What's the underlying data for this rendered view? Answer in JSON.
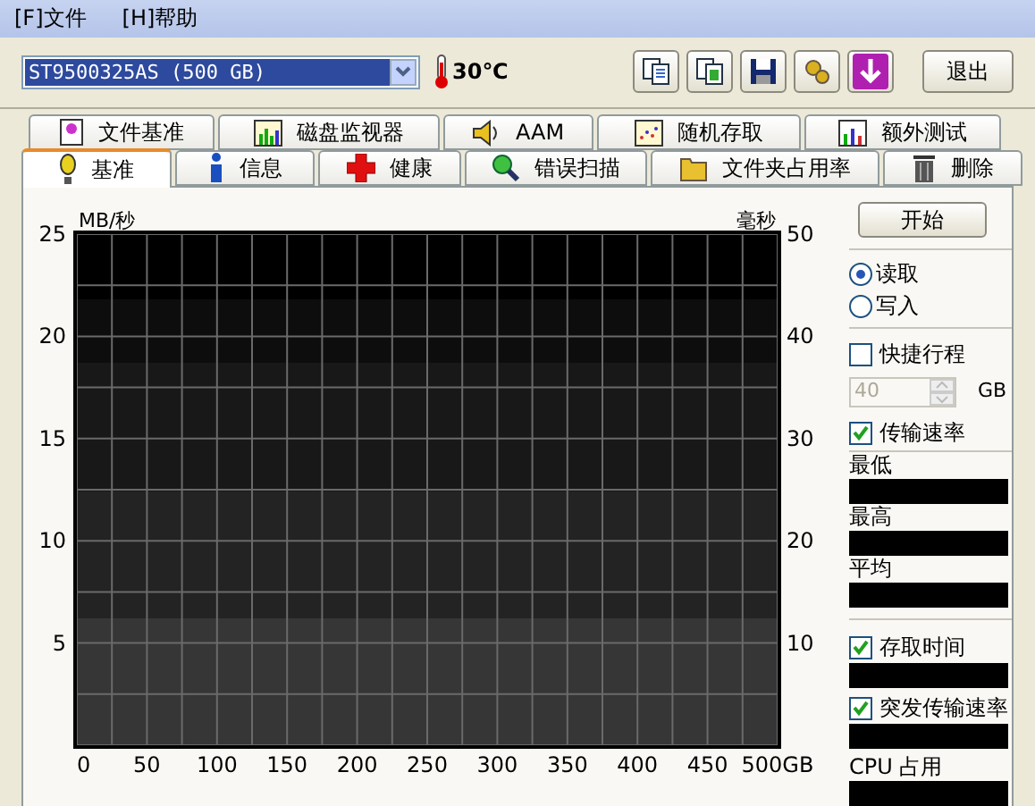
{
  "menu": [
    {
      "label": "[F]文件"
    },
    {
      "label": "[H]帮助"
    }
  ],
  "toolbar": {
    "drive": "ST9500325AS (500 GB)",
    "temperature": "30℃",
    "tools": [
      {
        "kind": "copy"
      },
      {
        "kind": "copy-color"
      },
      {
        "kind": "save"
      },
      {
        "kind": "options"
      },
      {
        "kind": "download"
      }
    ],
    "exit": "退出"
  },
  "tabs_top": [
    {
      "label": "文件基准",
      "kind": "file",
      "selected": false
    },
    {
      "label": "磁盘监视器",
      "kind": "monitor",
      "selected": false
    },
    {
      "label": "AAM",
      "kind": "speaker",
      "selected": false
    },
    {
      "label": "随机存取",
      "kind": "random",
      "selected": false
    },
    {
      "label": "额外测试",
      "kind": "extra",
      "selected": false
    }
  ],
  "tabs_bottom": [
    {
      "label": "基准",
      "kind": "bulb",
      "selected": true
    },
    {
      "label": "信息",
      "kind": "info",
      "selected": false
    },
    {
      "label": "健康",
      "kind": "health",
      "selected": false
    },
    {
      "label": "错误扫描",
      "kind": "scan",
      "selected": false
    },
    {
      "label": "文件夹占用率",
      "kind": "folder",
      "selected": false
    },
    {
      "label": "删除",
      "kind": "trash",
      "selected": false
    }
  ],
  "chart": {
    "right_label": "毫秒",
    "right_ticks": [
      "50",
      "40",
      "30",
      "20",
      "10"
    ],
    "chart_data": {
      "type": "line",
      "grid": true,
      "ylabel": "MB/秒",
      "xlim": [
        0,
        500
      ],
      "ylim": [
        0,
        25
      ],
      "xticks": [
        0,
        50,
        100,
        150,
        200,
        250,
        300,
        350,
        400,
        450,
        {
          "value": 500,
          "label": "500GB"
        }
      ],
      "yticks": [
        5,
        10,
        15,
        20,
        25
      ]
    }
  },
  "side": {
    "start": "开始",
    "modes": [
      {
        "label": "读取",
        "selected": true
      },
      {
        "label": "写入",
        "selected": false
      }
    ],
    "short_stroke": {
      "label": "快捷行程",
      "checked": false
    },
    "stroke_size": {
      "value": "40",
      "unit": "GB",
      "disabled": true
    },
    "transfer": {
      "label": "传输速率",
      "checked": true
    },
    "readouts": [
      {
        "label": "最低"
      },
      {
        "label": "最高"
      },
      {
        "label": "平均"
      }
    ],
    "access": {
      "label": "存取时间",
      "checked": true
    },
    "burst": {
      "label": "突发传输速率",
      "checked": true
    },
    "cpu": {
      "label": "CPU 占用"
    }
  }
}
